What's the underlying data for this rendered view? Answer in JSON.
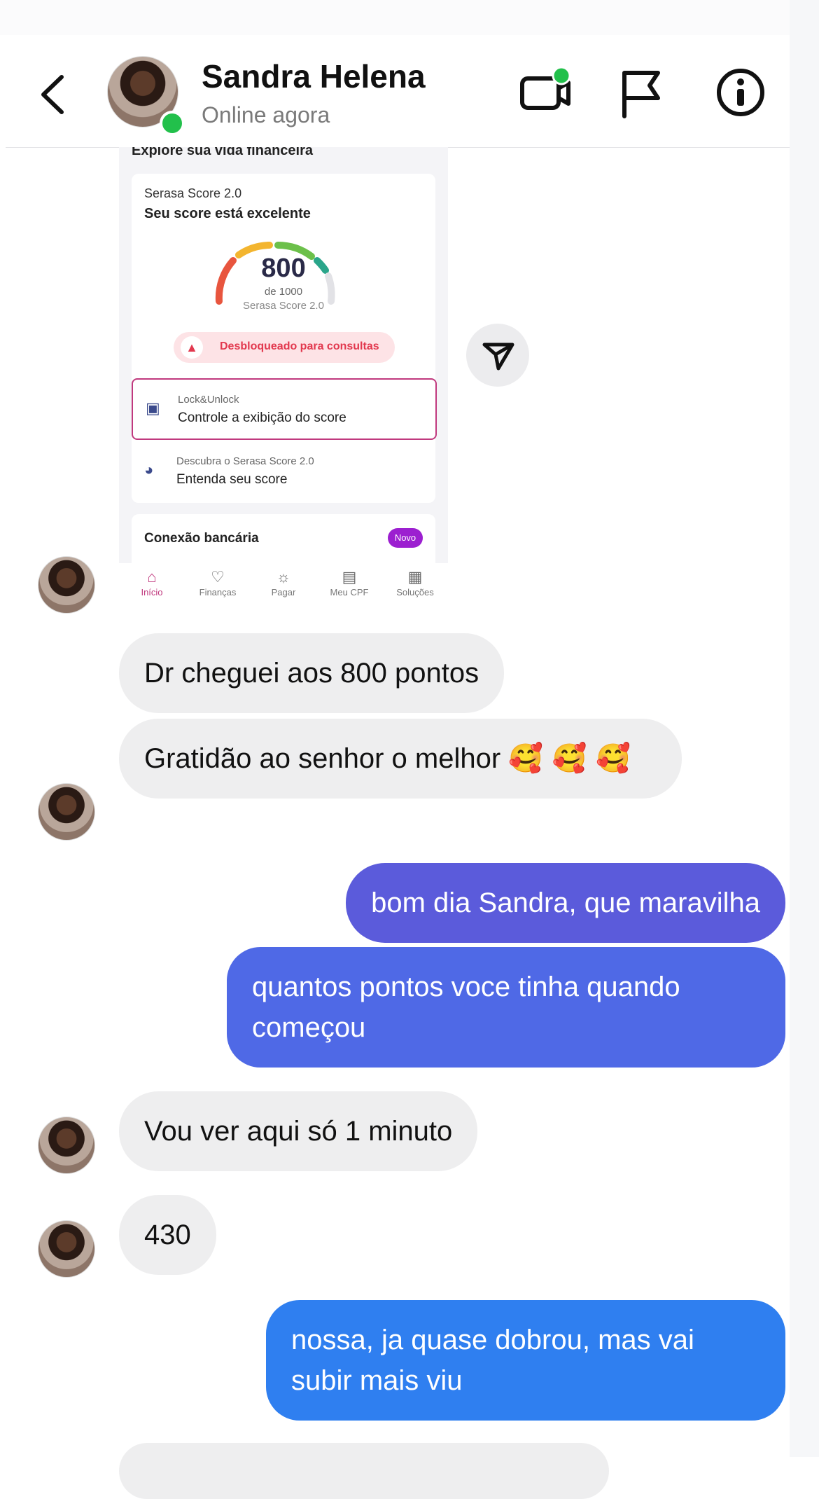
{
  "contact": {
    "name": "Sandra Helena",
    "status": "Online agora"
  },
  "header_icons": [
    "back-icon",
    "video-call-icon",
    "flag-icon",
    "info-icon"
  ],
  "shared_screenshot": {
    "section_title": "Explore sua vida financeira",
    "score_label": "Serasa Score 2.0",
    "score_heading": "Seu score está excelente",
    "score_value": "800",
    "score_of": "de 1000",
    "score_sub": "Serasa Score 2.0",
    "unlock_text": "Desbloqueado para consultas",
    "lock_small": "Lock&Unlock",
    "lock_main": "Controle a exibição do score",
    "discover_small": "Descubra o Serasa Score 2.0",
    "discover_main": "Entenda seu score",
    "bank_title": "Conexão bancária",
    "bank_badge": "Novo",
    "tabs": [
      "Início",
      "Finanças",
      "Pagar",
      "Meu CPF",
      "Soluções"
    ]
  },
  "messages": [
    {
      "side": "in",
      "text": "Dr cheguei aos 800 pontos"
    },
    {
      "side": "in",
      "text": "Gratidão ao senhor o melhor",
      "emoji": "🥰 🥰 🥰"
    },
    {
      "side": "out",
      "text": "bom dia Sandra, que maravilha",
      "color": "#5b5bdb"
    },
    {
      "side": "out",
      "text": "quantos pontos voce tinha quando começou",
      "color": "#4f69e6"
    },
    {
      "side": "in",
      "text": "Vou ver aqui só 1 minuto"
    },
    {
      "side": "in",
      "text": "430"
    },
    {
      "side": "out",
      "text": "nossa, ja quase dobrou, mas vai subir mais viu",
      "color": "#2f7ff0"
    }
  ]
}
